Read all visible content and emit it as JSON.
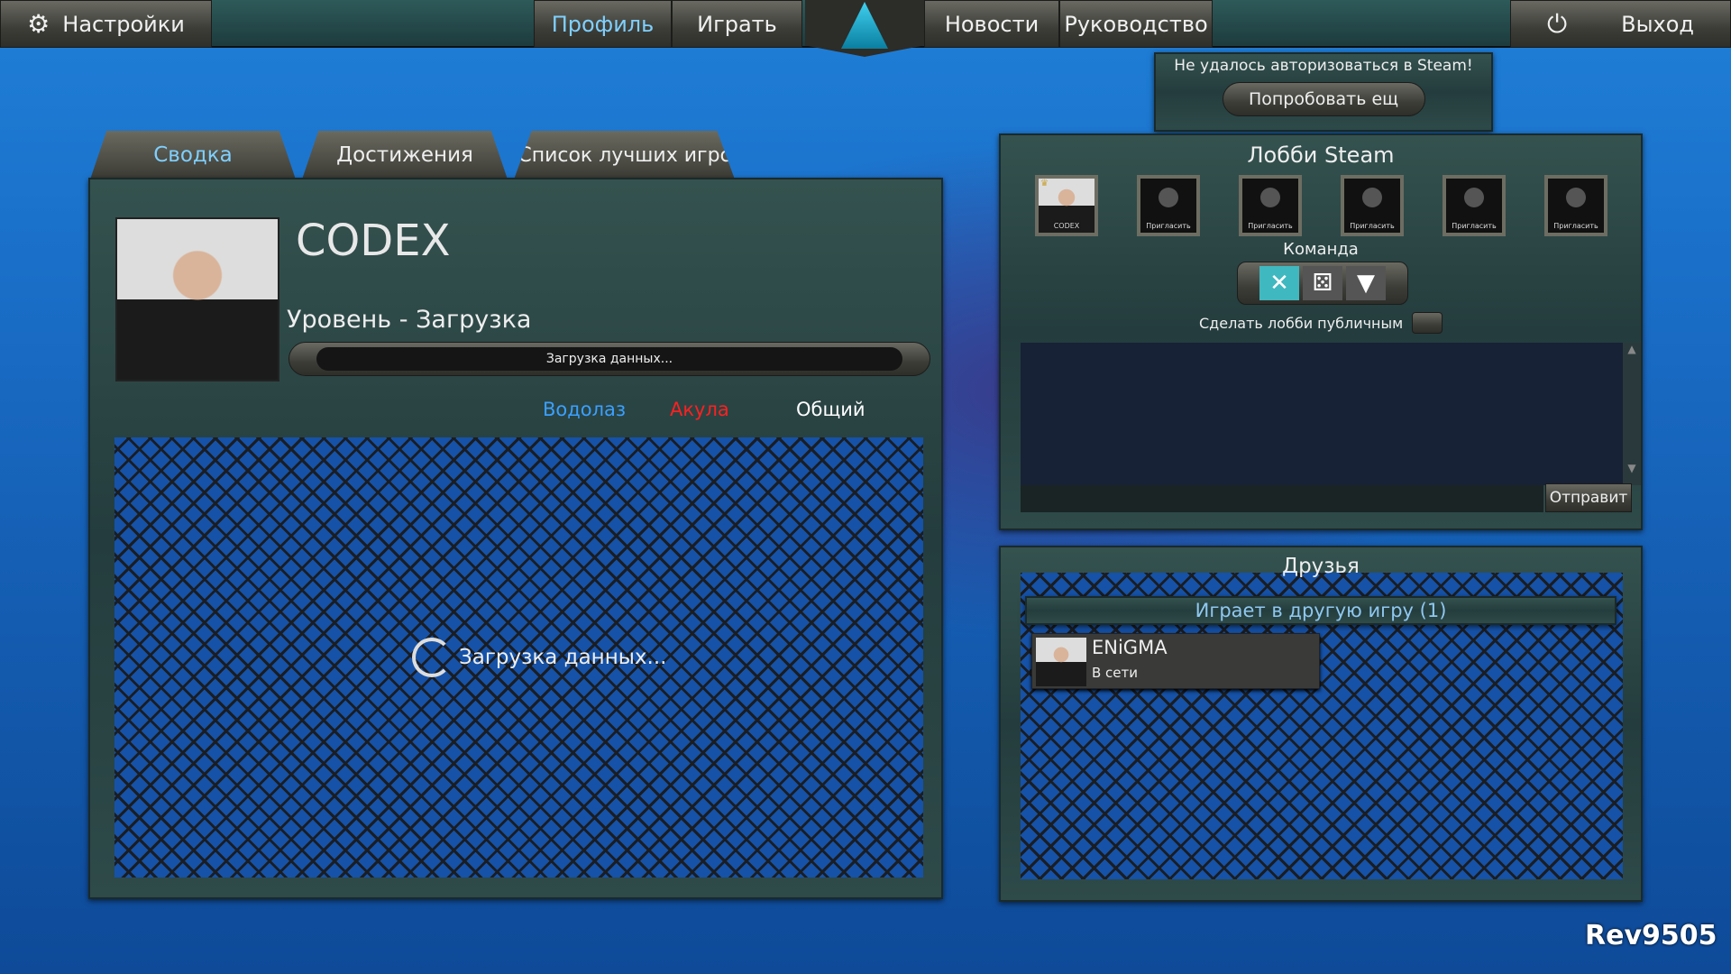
{
  "topbar": {
    "settings": "Настройки",
    "profile": "Профиль",
    "play": "Играть",
    "news": "Новости",
    "guide": "Руководство",
    "exit": "Выход",
    "active_color": "#7fd0ff"
  },
  "steam_error": {
    "message": "Не удалось авторизоваться в Steam!",
    "retry": "Попробовать ещ"
  },
  "tabs": [
    {
      "label": "Сводка",
      "active": true
    },
    {
      "label": "Достижения"
    },
    {
      "label": "Список лучших игрс"
    }
  ],
  "profile": {
    "name": "CODEX",
    "level": "Уровень - Загрузка",
    "progress_text": "Загрузка данных...",
    "subtabs": [
      {
        "label": "Водолаз",
        "color": "#3aa0ff"
      },
      {
        "label": "Акула",
        "color": "#ff2020"
      },
      {
        "label": "Общий",
        "color": "#ffffff"
      }
    ],
    "loading": "Загрузка данных..."
  },
  "lobby": {
    "title": "Лобби Steam",
    "slots": [
      {
        "label": "CODEX",
        "host": true
      },
      {
        "label": "Пригласить"
      },
      {
        "label": "Пригласить"
      },
      {
        "label": "Пригласить"
      },
      {
        "label": "Пригласить"
      },
      {
        "label": "Пригласить"
      }
    ],
    "team_label": "Команда",
    "team_icons": [
      "crossed-spears-icon",
      "dice-icon",
      "shark-tooth-icon"
    ],
    "public_label": "Сделать лобби публичным",
    "send": "Отправит"
  },
  "friends": {
    "title": "Друзья",
    "group": "Играет в другую игру (1)",
    "items": [
      {
        "name": "ENiGMA",
        "status": "В сети"
      }
    ]
  },
  "version": "Rev9505"
}
